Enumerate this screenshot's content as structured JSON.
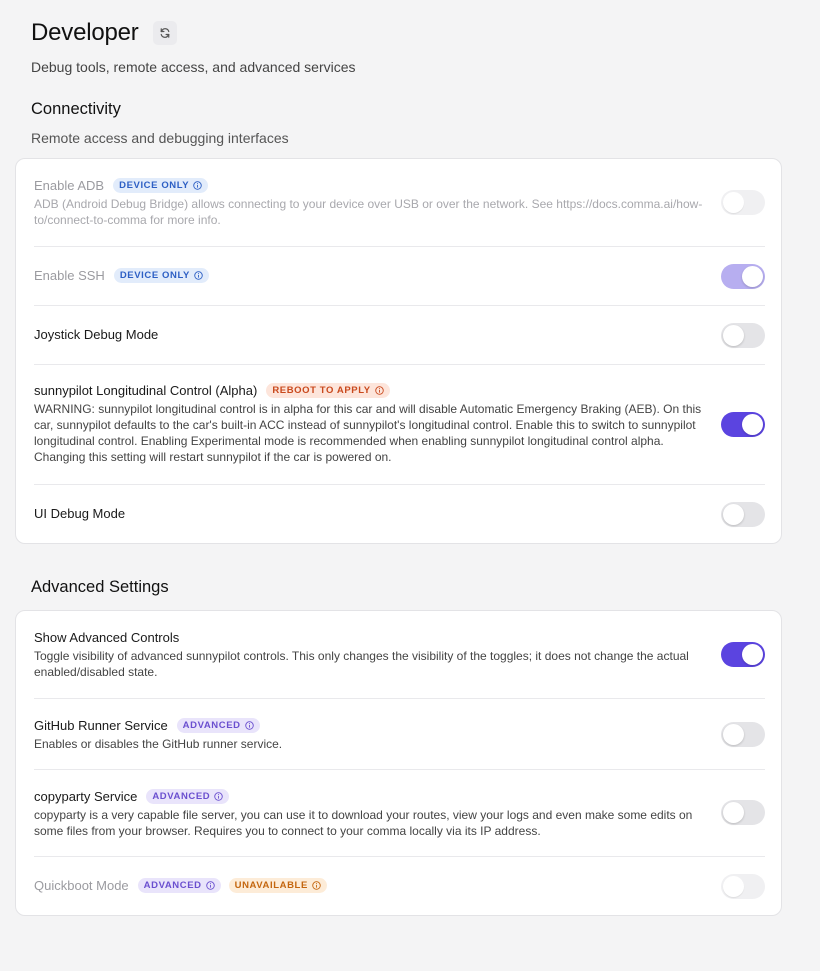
{
  "page": {
    "title": "Developer",
    "subtitle": "Debug tools, remote access, and advanced services"
  },
  "connectivity": {
    "title": "Connectivity",
    "subtitle": "Remote access and debugging interfaces",
    "items": [
      {
        "title": "Enable ADB",
        "badges": [
          "DEVICE ONLY"
        ],
        "description": "ADB (Android Debug Bridge) allows connecting to your device over USB or over the network. See https://docs.comma.ai/how-to/connect-to-comma for more info.",
        "enabled": false,
        "interactive": false
      },
      {
        "title": "Enable SSH",
        "badges": [
          "DEVICE ONLY"
        ],
        "description": "",
        "enabled": true,
        "interactive": false
      },
      {
        "title": "Joystick Debug Mode",
        "badges": [],
        "description": "",
        "enabled": false,
        "interactive": true
      },
      {
        "title": "sunnypilot Longitudinal Control (Alpha)",
        "badges": [
          "REBOOT TO APPLY"
        ],
        "description": "WARNING: sunnypilot longitudinal control is in alpha for this car and will disable Automatic Emergency Braking (AEB). On this car, sunnypilot defaults to the car's built-in ACC instead of sunnypilot's longitudinal control. Enable this to switch to sunnypilot longitudinal control. Enabling Experimental mode is recommended when enabling sunnypilot longitudinal control alpha. Changing this setting will restart sunnypilot if the car is powered on.",
        "enabled": true,
        "interactive": true
      },
      {
        "title": "UI Debug Mode",
        "badges": [],
        "description": "",
        "enabled": false,
        "interactive": true
      }
    ]
  },
  "advanced": {
    "title": "Advanced Settings",
    "items": [
      {
        "title": "Show Advanced Controls",
        "badges": [],
        "description": "Toggle visibility of advanced sunnypilot controls. This only changes the visibility of the toggles; it does not change the actual enabled/disabled state.",
        "enabled": true,
        "interactive": true
      },
      {
        "title": "GitHub Runner Service",
        "badges": [
          "ADVANCED"
        ],
        "description": "Enables or disables the GitHub runner service.",
        "enabled": false,
        "interactive": true
      },
      {
        "title": "copyparty Service",
        "badges": [
          "ADVANCED"
        ],
        "description": "copyparty is a very capable file server, you can use it to download your routes, view your logs and even make some edits on some files from your browser. Requires you to connect to your comma locally via its IP address.",
        "enabled": false,
        "interactive": true
      },
      {
        "title": "Quickboot Mode",
        "badges": [
          "ADVANCED",
          "UNAVAILABLE"
        ],
        "description": "",
        "enabled": false,
        "interactive": false
      }
    ]
  },
  "colors": {
    "accent": "#5b44e0",
    "accent_disabled": "#b7aef0",
    "background": "#f4f4f5",
    "card": "#ffffff"
  },
  "icons": {
    "refresh": "refresh-icon",
    "badge_info": "info-icon"
  }
}
